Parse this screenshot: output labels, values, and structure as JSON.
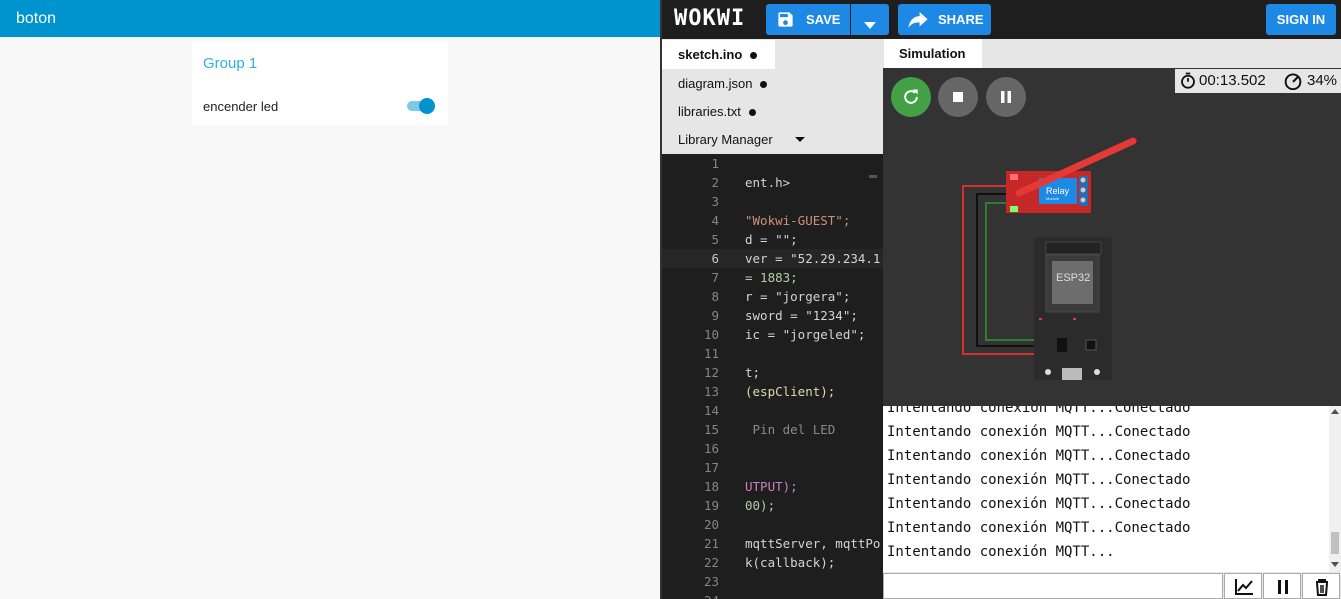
{
  "dashboard": {
    "title": "boton",
    "group": {
      "title": "Group 1",
      "switch_label": "encender led",
      "switch_on": true
    }
  },
  "wokwi": {
    "logo": "WOKWI",
    "toolbar": {
      "save_label": "SAVE",
      "share_label": "SHARE",
      "signin_label": "SIGN IN"
    },
    "file_tabs": [
      {
        "label": "sketch.ino",
        "active": true,
        "modified": true
      },
      {
        "label": "diagram.json",
        "active": false,
        "modified": true
      },
      {
        "label": "libraries.txt",
        "active": false,
        "modified": true
      },
      {
        "label": "Library Manager",
        "active": false,
        "dropdown": true
      }
    ],
    "code_lines": [
      {
        "n": "1",
        "t": ""
      },
      {
        "n": "2",
        "t": "ent.h>"
      },
      {
        "n": "3",
        "t": ""
      },
      {
        "n": "4",
        "t": "\"Wokwi-GUEST\";"
      },
      {
        "n": "5",
        "t": "d = \"\";"
      },
      {
        "n": "6",
        "t": "ver = \"52.29.234.1"
      },
      {
        "n": "7",
        "t": "= 1883;"
      },
      {
        "n": "8",
        "t": "r = \"jorgera\";"
      },
      {
        "n": "9",
        "t": "sword = \"1234\";"
      },
      {
        "n": "10",
        "t": "ic = \"jorgeled\";"
      },
      {
        "n": "11",
        "t": ""
      },
      {
        "n": "12",
        "t": "t;"
      },
      {
        "n": "13",
        "t": "(espClient);"
      },
      {
        "n": "14",
        "t": ""
      },
      {
        "n": "15",
        "t": " Pin del LED"
      },
      {
        "n": "16",
        "t": ""
      },
      {
        "n": "17",
        "t": ""
      },
      {
        "n": "18",
        "t": "UTPUT);"
      },
      {
        "n": "19",
        "t": "00);"
      },
      {
        "n": "20",
        "t": ""
      },
      {
        "n": "21",
        "t": "mqttServer, mqttPo"
      },
      {
        "n": "22",
        "t": "k(callback);"
      },
      {
        "n": "23",
        "t": ""
      },
      {
        "n": "24",
        "t": ""
      }
    ],
    "current_line": "6",
    "simulation": {
      "tab_label": "Simulation",
      "timer": "00:13.502",
      "cpu": "34%",
      "relay_label": "Relay",
      "relay_sublabel": "Module",
      "esp_label": "ESP32"
    },
    "serial_lines": [
      "Intentando conexión MQTT...Conectado",
      "Intentando conexión MQTT...Conectado",
      "Intentando conexión MQTT...Conectado",
      "Intentando conexión MQTT...Conectado",
      "Intentando conexión MQTT...Conectado",
      "Intentando conexión MQTT...Conectado",
      "Intentando conexión MQTT..."
    ],
    "icons": {
      "save": "floppy-icon",
      "dropdown": "chevron-down-icon",
      "share": "share-arrow-icon",
      "restart": "restart-icon",
      "stop": "stop-icon",
      "pause": "pause-icon",
      "timer": "stopwatch-icon",
      "cpu": "gauge-icon",
      "plot": "chart-icon",
      "serial_pause": "pause-icon",
      "clear": "trash-icon"
    },
    "colors": {
      "brand_blue": "#1e88e5",
      "dashboard_header": "#0094ce",
      "restart_green": "#43a047",
      "wire_red": "#d32f2f",
      "wire_green": "#2e7d32"
    }
  }
}
